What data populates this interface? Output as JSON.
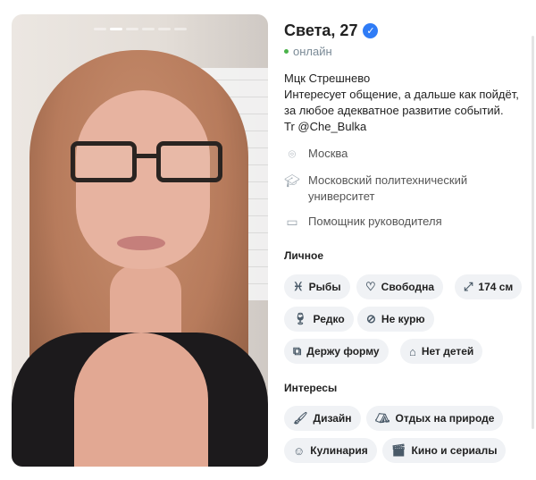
{
  "profile": {
    "name_age": "Света, 27",
    "status": "онлайн",
    "bio_lines": [
      "Мцк Стрешнево",
      "Интересует общение, а дальше как пойдёт,",
      "за любое адекватное развитие событий.",
      "Tr @Che_Bulka"
    ]
  },
  "details": {
    "city": "Москва",
    "university": "Московский политехнический университет",
    "job": "Помощник руководителя"
  },
  "personal": {
    "title": "Личное",
    "chips": [
      {
        "label": "Рыбы",
        "icon": "pisces-icon"
      },
      {
        "label": "Свободна",
        "icon": "heart-icon"
      },
      {
        "label": "174 см",
        "icon": "height-icon"
      },
      {
        "label": "Редко",
        "icon": "glass-icon"
      },
      {
        "label": "Не курю",
        "icon": "no-smoking-icon"
      },
      {
        "label": "Держу форму",
        "icon": "dumbbell-icon"
      },
      {
        "label": "Нет детей",
        "icon": "bottle-icon"
      }
    ]
  },
  "interests": {
    "title": "Интересы",
    "chips": [
      {
        "label": "Дизайн",
        "icon": "brush-icon"
      },
      {
        "label": "Отдых на природе",
        "icon": "tent-icon"
      },
      {
        "label": "Кулинария",
        "icon": "cook-icon"
      },
      {
        "label": "Кино и сериалы",
        "icon": "clapper-icon"
      }
    ]
  },
  "photo": {
    "total_photos": 6,
    "active_photo": 2
  },
  "colors": {
    "verified": "#2f7cf6",
    "online": "#4bb34b",
    "chip_bg": "#f0f2f5"
  }
}
